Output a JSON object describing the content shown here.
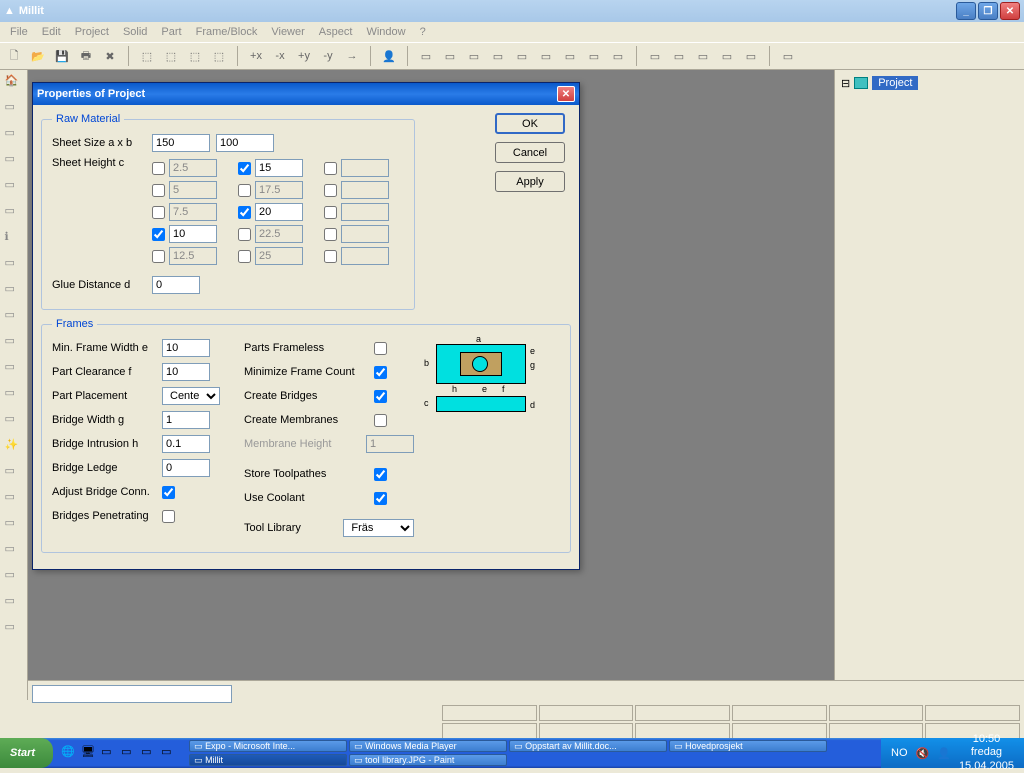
{
  "app": {
    "title": "Millit"
  },
  "menu": {
    "file": "File",
    "edit": "Edit",
    "project": "Project",
    "solid": "Solid",
    "part": "Part",
    "frameblock": "Frame/Block",
    "viewer": "Viewer",
    "aspect": "Aspect",
    "window": "Window",
    "help": "?"
  },
  "tree": {
    "root": "Project"
  },
  "dialog": {
    "title": "Properties of Project",
    "buttons": {
      "ok": "OK",
      "cancel": "Cancel",
      "apply": "Apply"
    },
    "raw_material": {
      "legend": "Raw Material",
      "sheet_size_label": "Sheet Size a x b",
      "sheet_a": "150",
      "sheet_b": "100",
      "sheet_height_label": "Sheet Height c",
      "heights": [
        {
          "checked": false,
          "value": "2.5",
          "disabled": true
        },
        {
          "checked": true,
          "value": "15",
          "disabled": false
        },
        {
          "checked": false,
          "value": "",
          "disabled": true
        },
        {
          "checked": false,
          "value": "5",
          "disabled": true
        },
        {
          "checked": false,
          "value": "17.5",
          "disabled": true
        },
        {
          "checked": false,
          "value": "",
          "disabled": true
        },
        {
          "checked": false,
          "value": "7.5",
          "disabled": true
        },
        {
          "checked": true,
          "value": "20",
          "disabled": false
        },
        {
          "checked": false,
          "value": "",
          "disabled": true
        },
        {
          "checked": true,
          "value": "10",
          "disabled": false
        },
        {
          "checked": false,
          "value": "22.5",
          "disabled": true
        },
        {
          "checked": false,
          "value": "",
          "disabled": true
        },
        {
          "checked": false,
          "value": "12.5",
          "disabled": true
        },
        {
          "checked": false,
          "value": "25",
          "disabled": true
        },
        {
          "checked": false,
          "value": "",
          "disabled": true
        }
      ],
      "glue_distance_label": "Glue Distance d",
      "glue_distance": "0"
    },
    "frames": {
      "legend": "Frames",
      "min_frame_width_label": "Min. Frame Width e",
      "min_frame_width": "10",
      "part_clearance_label": "Part Clearance f",
      "part_clearance": "10",
      "part_placement_label": "Part Placement",
      "part_placement": "Center",
      "bridge_width_label": "Bridge Width g",
      "bridge_width": "1",
      "bridge_intrusion_label": "Bridge Intrusion h",
      "bridge_intrusion": "0.1",
      "bridge_ledge_label": "Bridge Ledge",
      "bridge_ledge": "0",
      "adjust_bridge_label": "Adjust Bridge Conn.",
      "adjust_bridge": true,
      "bridges_penetrating_label": "Bridges Penetrating",
      "bridges_penetrating": false,
      "parts_frameless_label": "Parts Frameless",
      "parts_frameless": false,
      "minimize_frame_label": "Minimize Frame Count",
      "minimize_frame": true,
      "create_bridges_label": "Create Bridges",
      "create_bridges": true,
      "create_membranes_label": "Create Membranes",
      "create_membranes": false,
      "membrane_height_label": "Membrane Height",
      "membrane_height": "1",
      "store_toolpathes_label": "Store Toolpathes",
      "store_toolpathes": true,
      "use_coolant_label": "Use Coolant",
      "use_coolant": true,
      "tool_library_label": "Tool Library",
      "tool_library": "Fräs"
    }
  },
  "taskbar": {
    "start": "Start",
    "items": [
      "Expo - Microsoft Inte...",
      "Windows Media Player",
      "Oppstart av Millit.doc...",
      "Hovedprosjekt",
      "Millit",
      "tool library.JPG - Paint"
    ],
    "lang": "NO",
    "time": "10:50",
    "day": "fredag",
    "date": "15.04.2005"
  }
}
